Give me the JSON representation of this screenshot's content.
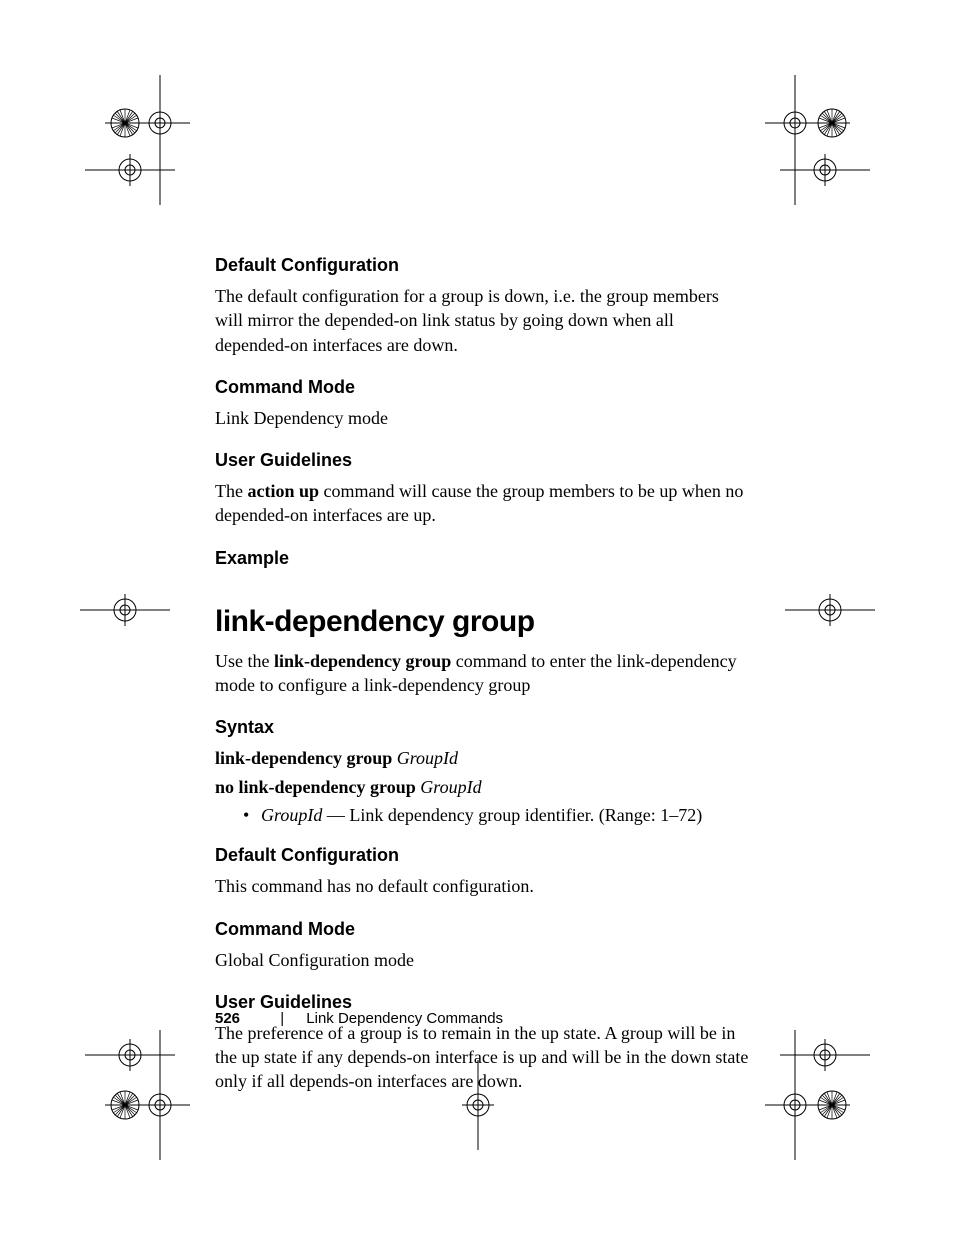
{
  "sections": [
    {
      "heading": "Default Configuration",
      "body": "The default configuration for a group is down, i.e. the group members will mirror the depended-on link status by going down when all depended-on interfaces are down."
    },
    {
      "heading": "Command Mode",
      "body": "Link Dependency mode"
    },
    {
      "heading_ug1": "User Guidelines",
      "ug1_pre": "The ",
      "ug1_bold": "action up",
      "ug1_post": " command will cause the group members to be up when no depended-on interfaces are up."
    },
    {
      "heading": "Example",
      "body": ""
    }
  ],
  "command": {
    "title": "link-dependency group",
    "intro_pre": "Use the ",
    "intro_bold": "link-dependency group",
    "intro_post": " command to enter the link-dependency mode to configure a link-dependency group"
  },
  "syntax": {
    "heading": "Syntax",
    "line1_bold": "link-dependency group ",
    "line1_ital": "GroupId",
    "line2_bold": "no link-dependency group ",
    "line2_ital": "GroupId",
    "bullet_ital": "GroupId",
    "bullet_rest": " — Link dependency group identifier. (Range: 1–72)"
  },
  "defconf2": {
    "heading": "Default Configuration",
    "body": "This command has no default configuration."
  },
  "cmdmode2": {
    "heading": "Command Mode",
    "body": "Global Configuration mode"
  },
  "ug2": {
    "heading": "User Guidelines",
    "body": "The preference of a group is to remain in the up state. A group will be in the up state if any depends-on interface is up and will be in the down state only if all depends-on interfaces are down."
  },
  "footer": {
    "page": "526",
    "sep": "|",
    "chapter": "Link Dependency Commands"
  }
}
